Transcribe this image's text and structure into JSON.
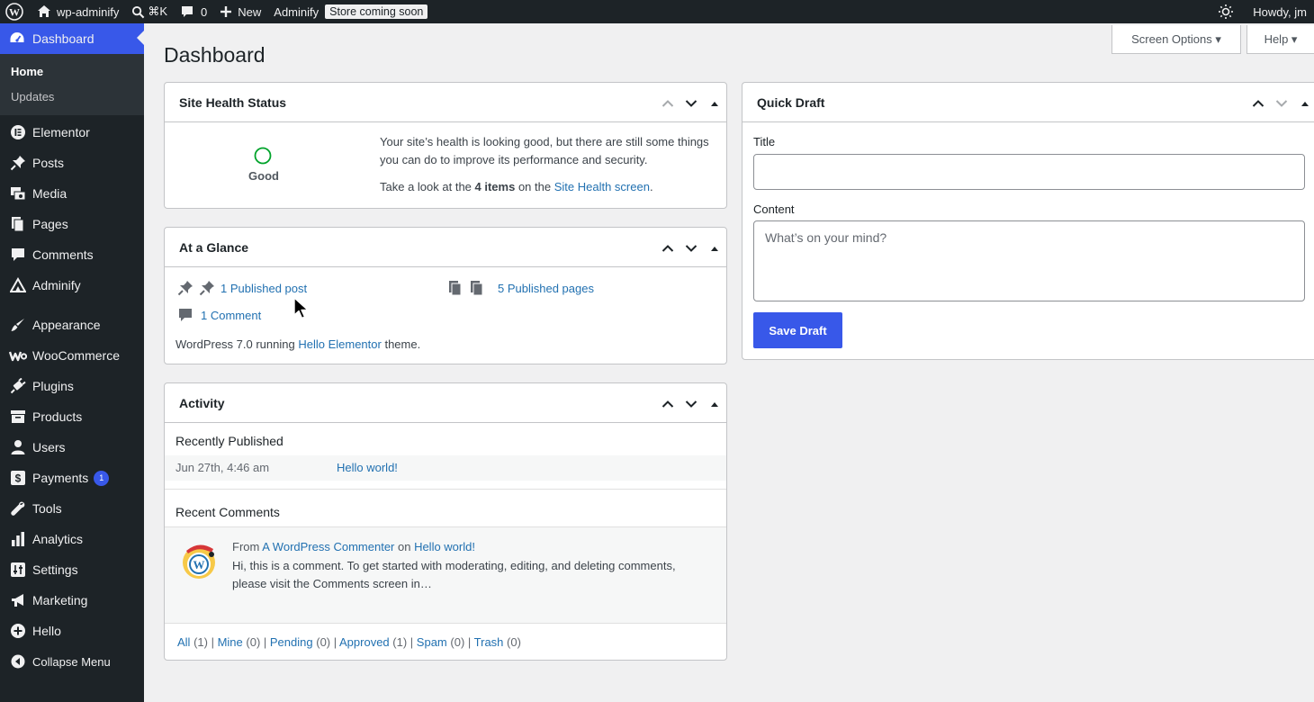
{
  "adminbar": {
    "site_name": "wp-adminify",
    "search_shortcut": "⌘K",
    "comments_count": "0",
    "new_label": "New",
    "adminify_label": "Adminify",
    "store_badge": "Store coming soon",
    "howdy": "Howdy, jm"
  },
  "sidebar": {
    "dashboard": "Dashboard",
    "submenu": [
      "Home",
      "Updates"
    ],
    "items": [
      {
        "label": "Elementor",
        "icon": "elementor-icon"
      },
      {
        "label": "Posts",
        "icon": "pin-icon"
      },
      {
        "label": "Media",
        "icon": "media-icon"
      },
      {
        "label": "Pages",
        "icon": "pages-icon"
      },
      {
        "label": "Comments",
        "icon": "comment-icon"
      },
      {
        "label": "Adminify",
        "icon": "adminify-icon"
      },
      {
        "label": "Appearance",
        "icon": "brush-icon"
      },
      {
        "label": "WooCommerce",
        "icon": "woocommerce-icon"
      },
      {
        "label": "Plugins",
        "icon": "plugin-icon"
      },
      {
        "label": "Products",
        "icon": "archive-icon"
      },
      {
        "label": "Users",
        "icon": "user-icon"
      },
      {
        "label": "Payments",
        "icon": "payments-icon",
        "count": "1"
      },
      {
        "label": "Tools",
        "icon": "wrench-icon"
      },
      {
        "label": "Analytics",
        "icon": "bar-chart-icon"
      },
      {
        "label": "Settings",
        "icon": "settings-icon"
      },
      {
        "label": "Marketing",
        "icon": "megaphone-icon"
      },
      {
        "label": "Hello",
        "icon": "plus-circle-icon"
      },
      {
        "label": "Collapse Menu",
        "icon": "collapse-icon"
      }
    ]
  },
  "page": {
    "title": "Dashboard",
    "screen_options": "Screen Options ▾",
    "help": "Help ▾"
  },
  "site_health": {
    "title": "Site Health Status",
    "status": "Good",
    "message": "Your site’s health is looking good, but there are still some things you can do to improve its performance and security.",
    "take_look_prefix": "Take a look at the ",
    "items_count": "4 items",
    "take_look_mid": " on the ",
    "link": "Site Health screen",
    "suffix": "."
  },
  "glance": {
    "title": "At a Glance",
    "posts": "1 Published post",
    "pages": "5 Published pages",
    "comments": "1 Comment",
    "wp_prefix": "WordPress 7.0 running ",
    "theme": "Hello Elementor",
    "wp_suffix": " theme."
  },
  "activity": {
    "title": "Activity",
    "recently_published": "Recently Published",
    "published_date": "Jun 27th, 4:46 am",
    "published_title": "Hello world!",
    "recent_comments": "Recent Comments",
    "comment_from": "From ",
    "comment_author": "A WordPress Commenter",
    "comment_on": " on ",
    "comment_post": "Hello world!",
    "comment_text": "Hi, this is a comment. To get started with moderating, editing, and deleting comments, please visit the Comments screen in…",
    "filters": [
      {
        "label": "All",
        "count": "(1)"
      },
      {
        "label": "Mine",
        "count": "(0)"
      },
      {
        "label": "Pending",
        "count": "(0)"
      },
      {
        "label": "Approved",
        "count": "(1)"
      },
      {
        "label": "Spam",
        "count": "(0)"
      },
      {
        "label": "Trash",
        "count": "(0)"
      }
    ]
  },
  "quick_draft": {
    "title": "Quick Draft",
    "title_label": "Title",
    "content_label": "Content",
    "content_placeholder": "What’s on your mind?",
    "save_label": "Save Draft"
  },
  "colors": {
    "accent": "#3858e9",
    "adminbar": "#1d2327",
    "link": "#2271b1",
    "good": "#00a32a"
  }
}
